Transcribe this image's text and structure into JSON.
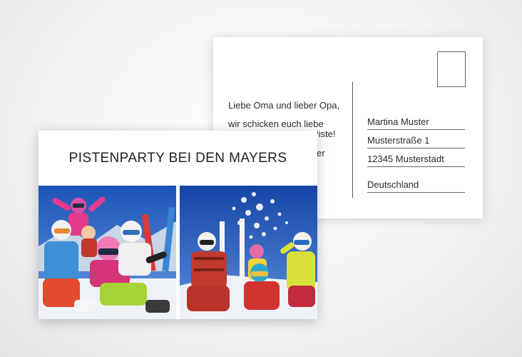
{
  "back": {
    "message_lines": [
      "Liebe Oma und lieber Opa,",
      "wir schicken euch liebe",
      "Piste!",
      "er"
    ],
    "address": {
      "name": "Martina Muster",
      "street": "Musterstraße 1",
      "city": "12345 Musterstadt",
      "country": "Deutschland"
    }
  },
  "front": {
    "title": "PISTENPARTY BEI DEN MAYERS"
  },
  "colors": {
    "sky_blue": "#1f5fc0",
    "snow": "#eef2f7",
    "text": "#222222"
  }
}
